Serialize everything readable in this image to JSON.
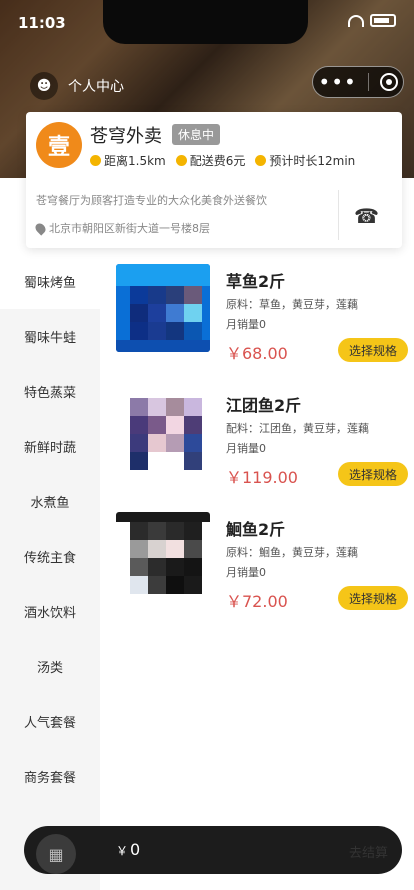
{
  "status": {
    "time": "11:03"
  },
  "header": {
    "personal_center": "个人中心"
  },
  "shop": {
    "logo_text": "壹",
    "name": "苍穹外卖",
    "status_badge": "休息中",
    "distance": "距离1.5km",
    "delivery_fee": "配送费6元",
    "eta": "预计时长12min",
    "description": "苍穹餐厅为顾客打造专业的大众化美食外送餐饮",
    "address": "北京市朝阳区新街大道一号楼8层"
  },
  "categories": [
    "蜀味烤鱼",
    "蜀味牛蛙",
    "特色蒸菜",
    "新鲜时蔬",
    "水煮鱼",
    "传统主食",
    "酒水饮料",
    "汤类",
    "人气套餐",
    "商务套餐"
  ],
  "dishes": [
    {
      "name": "草鱼2斤",
      "ingredients": "原料：草鱼，黄豆芽，莲藕",
      "sales": "月销量0",
      "price": "￥68.00",
      "button": "选择规格"
    },
    {
      "name": "江团鱼2斤",
      "ingredients": "配料：江团鱼，黄豆芽，莲藕",
      "sales": "月销量0",
      "price": "￥119.00",
      "button": "选择规格"
    },
    {
      "name": "鮰鱼2斤",
      "ingredients": "原料：鮰鱼，黄豆芽，莲藕",
      "sales": "月销量0",
      "price": "￥72.00",
      "button": "选择规格"
    }
  ],
  "cart": {
    "currency": "￥",
    "total": "0",
    "checkout": "去结算"
  },
  "colors": {
    "accent": "#f5c518",
    "price": "#d9534f",
    "cart_bg": "#1c1c1c"
  },
  "icons": [
    "person-icon",
    "more-dots-icon",
    "target-icon",
    "clock-icon",
    "fee-icon",
    "timer-icon",
    "location-pin-icon",
    "phone-icon",
    "cart-icon"
  ]
}
